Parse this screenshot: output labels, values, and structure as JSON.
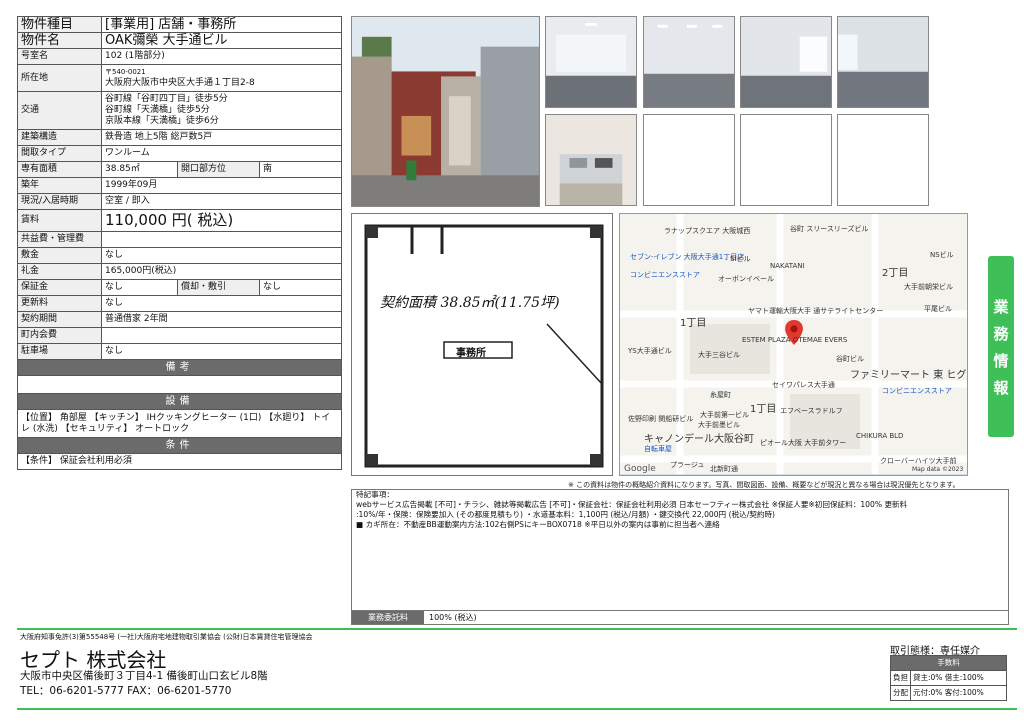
{
  "spec": {
    "type_label": "物件種目",
    "type_value": "[事業用] 店舗・事務所",
    "name_label": "物件名",
    "name_value": "OAK彌榮 大手通ビル",
    "room_label": "号室名",
    "room_value": "102 (1階部分)",
    "address_label": "所在地",
    "postal": "〒540-0021",
    "address": "大阪府大阪市中央区大手通１丁目2-8",
    "transit_label": "交通",
    "transit": [
      "谷町線「谷町四丁目」徒歩5分",
      "谷町線「天満橋」徒歩5分",
      "京阪本線「天満橋」徒歩6分"
    ],
    "structure_label": "建築構造",
    "structure_value": "鉄骨造 地上5階 総戸数5戸",
    "layout_label": "間取タイプ",
    "layout_value": "ワンルーム",
    "area_label": "専有面積",
    "area_value": "38.85㎡",
    "opening_label": "開口部方位",
    "opening_value": "南",
    "built_label": "築年",
    "built_value": "1999年09月",
    "status_label": "現況/入居時期",
    "status_value": "空室 / 即入",
    "rent_label": "賃料",
    "rent_value": "110,000 円( 税込)",
    "common_label": "共益費・管理費",
    "common_value": "",
    "deposit_label": "敷金",
    "deposit_value": "なし",
    "key_money_label": "礼金",
    "key_money_value": "165,000円(税込)",
    "guarantee_label": "保証金",
    "guarantee_value": "なし",
    "amortization_label": "償却・敷引",
    "amortization_value": "なし",
    "renewal_label": "更新料",
    "renewal_value": "なし",
    "contract_label": "契約期間",
    "contract_value": "普通借家 2年間",
    "town_fee_label": "町内会費",
    "town_fee_value": "",
    "parking_label": "駐車場",
    "parking_value": "なし",
    "remarks_header": "備考",
    "remarks_value": "",
    "equipment_header": "設備",
    "equipment_value": "【位置】 角部屋 【キッチン】 IHクッキングヒーター (1口) 【水廻り】 トイレ (水洗) 【セキュリティ】 オートロック",
    "conditions_header": "条件",
    "conditions_value": "【条件】 保証会社利用必須"
  },
  "floor_plan": {
    "area_note": "契約面積 38.85㎡(11.75坪)",
    "room_label": "事務所"
  },
  "map": {
    "labels": [
      "ラナップスクエア 大阪城西",
      "谷町 スリースリーズビル",
      "セブン-イレブン 大阪大手通1丁目店",
      "コンビニエンスストア",
      "SIビル",
      "NAKATANI",
      "NSビル",
      "2丁目",
      "大手前朝栄ビル",
      "平尾ビル",
      "オーボンイベール",
      "ヤマト運輸大阪大手 通サテライトセンター",
      "1丁目",
      "ESTEM PLAZA OTEMAE EVERS",
      "YS大手通ビル",
      "大手三谷ビル",
      "谷町ビル",
      "ファミリーマート 東 ヒグチ谷町二丁目店",
      "コンビニエンスストア",
      "セイワパレス大手通",
      "糸屋町",
      "大手前第一ビル",
      "1丁目",
      "エフベースラドルフ",
      "佐野印刷 関船研ビル",
      "大手前墨ビル",
      "キャノンデール大阪谷町",
      "自転車屋",
      "ピオール大阪 大手前タワー",
      "CHIKURA BLD",
      "プラージュ",
      "北新町通",
      "クローバーハイツ大手前",
      "Map data ©2023",
      "Google"
    ]
  },
  "side_tab": {
    "chars": [
      "業",
      "務",
      "情",
      "報"
    ]
  },
  "disclaimer": "※ この資料は物件の概略紹介資料になります。写真、間取図面、設備、概要などが現況と異なる場合は現況優先となります。",
  "notes": {
    "lines": [
      "特記事項：",
      "webサービス広告掲載 [不可]・チラシ、雑誌等掲載広告 [不可]・保証会社：保証会社利用必須 日本セーフティー株式会社 ※保証人要※初回保証料：100%  更新料",
      ":10%/年・保険：保険要加入 (その都度見積もり) ・水道基本料：1,100円 (税込/月額) ・鍵交換代 22,000円 (税込/契約時)",
      "■ カギ所在：不動産BB運動案内方法:102右側PSにキーBOX0718  ※平日以外の案内は事前に担当者へ連絡"
    ],
    "fee_label": "業務委託料",
    "fee_value": "100% (税込)"
  },
  "footer": {
    "license": "大阪府知事免許(3)第55548号 (一社)大阪府宅地建物取引業協会 (公財)日本賃貸住宅管理協会",
    "company": "セプト 株式会社",
    "address": "大阪市中央区備後町３丁目4-1 備後町山口玄ビル8階",
    "tel": "TEL：06-6201-5777  FAX：06-6201-5770",
    "deal_title": "取引態様：専任媒介",
    "fee_header": "手数料",
    "burden_label": "負担",
    "burden_value": "貸主:0% 借主:100%",
    "split_label": "分配",
    "split_value": "元付:0% 客付:100%"
  },
  "colors": {
    "accent_green": "#3fbf57",
    "header_gray": "#6b6b6b",
    "map_pin": "#e03a2f"
  }
}
